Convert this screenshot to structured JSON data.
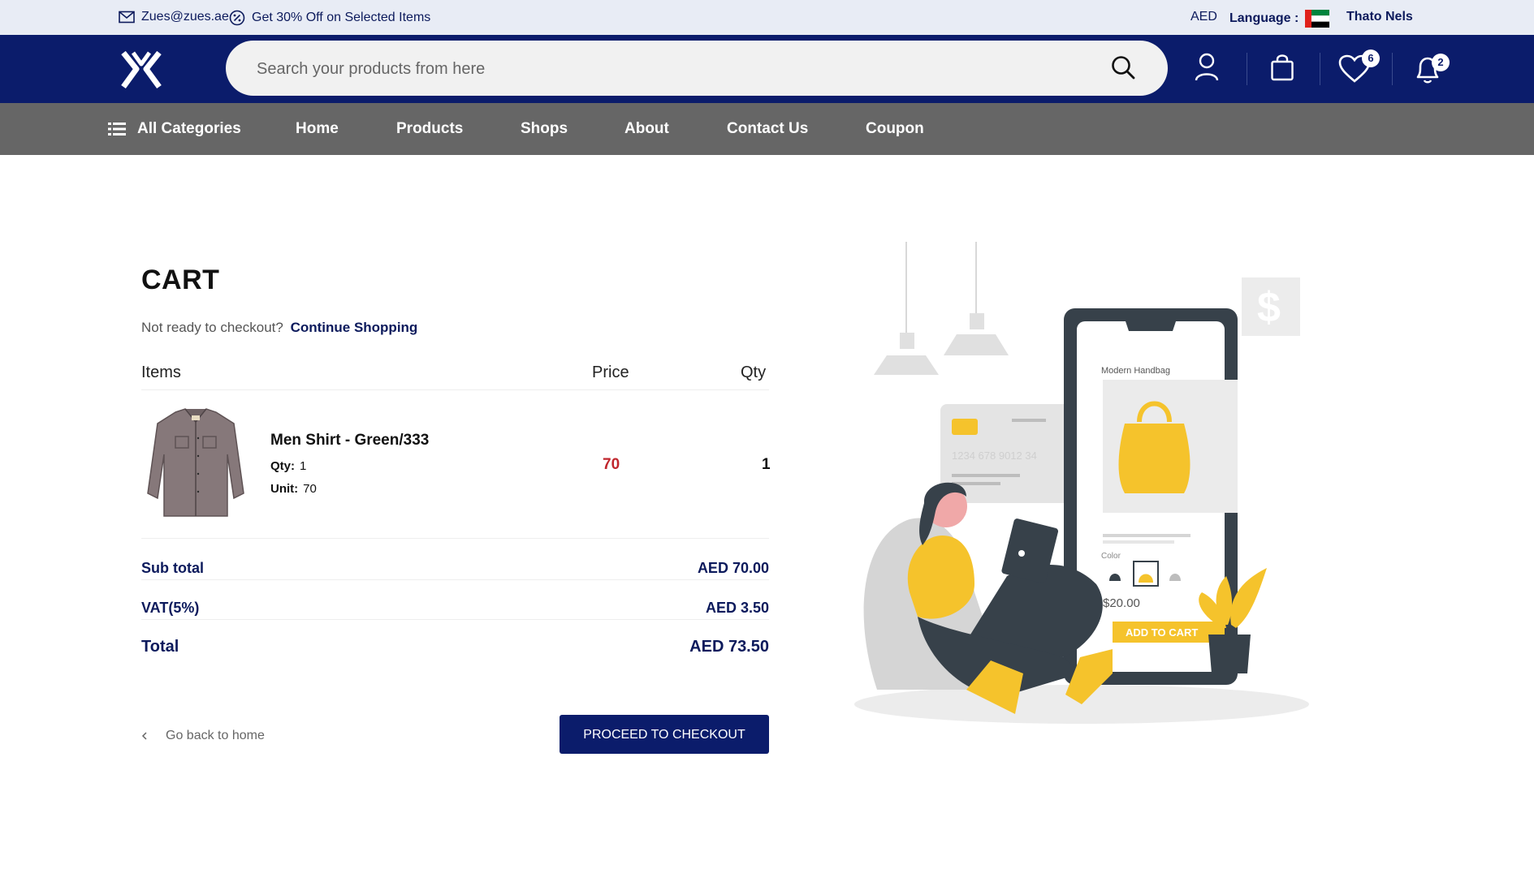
{
  "topbar": {
    "email": "Zues@zues.ae",
    "promo": "Get 30% Off on Selected Items",
    "currency": "AED",
    "language_label": "Language :",
    "user_name": "Thato Nels"
  },
  "header": {
    "search_placeholder": "Search your products from here",
    "wishlist_count": "6",
    "notification_count": "2"
  },
  "nav": {
    "all_categories": "All Categories",
    "links": [
      "Home",
      "Products",
      "Shops",
      "About",
      "Contact Us",
      "Coupon"
    ]
  },
  "cart": {
    "title": "CART",
    "not_ready": "Not ready to checkout?",
    "continue": "Continue Shopping",
    "columns": {
      "items": "Items",
      "price": "Price",
      "qty": "Qty"
    },
    "items": [
      {
        "name": "Men Shirt - Green/333",
        "qty_label": "Qty:",
        "qty": "1",
        "unit_label": "Unit:",
        "unit": "70",
        "price": "70",
        "quantity": "1"
      }
    ],
    "summary": {
      "subtotal_label": "Sub total",
      "subtotal": "AED 70.00",
      "vat_label": "VAT(5%)",
      "vat": "AED 3.50",
      "total_label": "Total",
      "total": "AED 73.50"
    },
    "back_home": "Go back to home",
    "checkout": "PROCEED TO CHECKOUT"
  },
  "illustration": {
    "card_number": "1234  678  9012  34",
    "product_title": "Modern Handbag",
    "color_label": "Color",
    "price": "$20.00",
    "add_to_cart": "ADD TO CART"
  },
  "colors": {
    "navy": "#0b1c6b",
    "nav_gray": "#666666",
    "price_red": "#c0262d",
    "accent_yellow": "#f5c32c"
  }
}
